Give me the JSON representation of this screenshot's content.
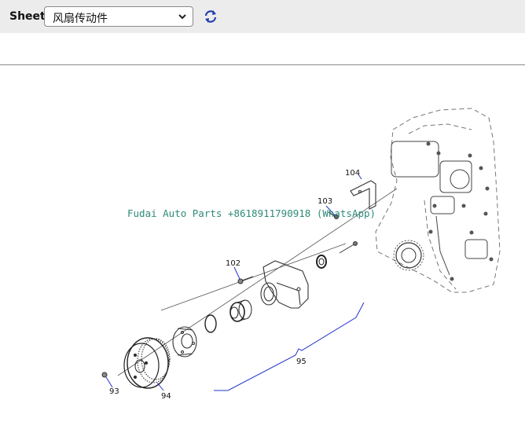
{
  "toolbar": {
    "sheet_label": "Sheet",
    "sheet_select_value": "风扇传动件",
    "refresh_icon": "refresh-icon"
  },
  "diagram": {
    "watermark": "Fudai Auto Parts +8618911790918 (WhatsApp)",
    "callouts": {
      "c93": "93",
      "c94": "94",
      "c95": "95",
      "c102": "102",
      "c103": "103",
      "c104": "104"
    },
    "colors": {
      "leader_blue": "#2233cc",
      "line_gray": "#333333",
      "dash_gray": "#777777",
      "watermark": "#2e8b7a"
    }
  }
}
